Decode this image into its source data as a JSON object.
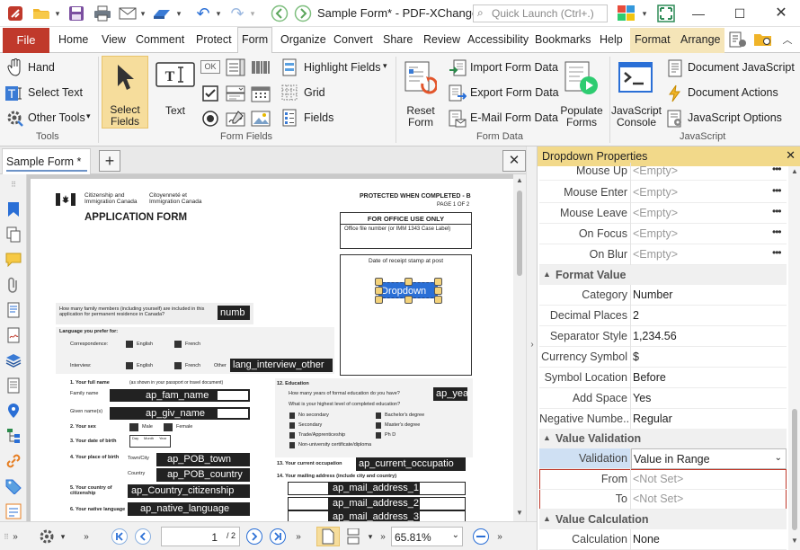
{
  "titlebar": {
    "title": "Sample Form* - PDF-XChange ...",
    "quick_launch_placeholder": "Quick Launch (Ctrl+.)"
  },
  "menu": {
    "file": "File",
    "tabs": [
      "Home",
      "View",
      "Comment",
      "Protect",
      "Form",
      "Organize",
      "Convert",
      "Share",
      "Review",
      "Accessibility",
      "Bookmarks",
      "Help",
      "Format",
      "Arrange"
    ],
    "active": "Form"
  },
  "ribbon": {
    "tools": {
      "hand": "Hand",
      "select_text": "Select Text",
      "other_tools": "Other Tools",
      "group": "Tools"
    },
    "form_fields": {
      "select_fields": "Select Fields",
      "text": "Text",
      "highlight_fields": "Highlight Fields",
      "grid": "Grid",
      "fields": "Fields",
      "group": "Form Fields",
      "ok_label": "OK"
    },
    "form_data": {
      "reset_form": "Reset Form",
      "import": "Import Form Data",
      "export": "Export Form Data",
      "email": "E-Mail Form Data",
      "populate": "Populate Forms",
      "group": "Form Data"
    },
    "javascript": {
      "console": "JavaScript Console",
      "doc_js": "Document JavaScript",
      "doc_actions": "Document Actions",
      "js_options": "JavaScript Options",
      "group": "JavaScript"
    }
  },
  "document_tab": {
    "name": "Sample Form *"
  },
  "document": {
    "header_left1": "Citizenship and Immigration Canada",
    "header_left2": "Citoyenneté et Immigration Canada",
    "protected": "PROTECTED WHEN COMPLETED - B",
    "page_of": "PAGE 1 OF 2",
    "title": "APPLICATION FORM",
    "office_use": "FOR OFFICE USE ONLY",
    "office_file": "Office file number (or IMM 1343 Case Label)",
    "receipt_stamp": "Date of receipt stamp at post",
    "dropdown_label": "Dropdown",
    "family_members_q": "How many family members (including yourself) are included in this application for permanent residence in Canada?",
    "family_members_field": "numb",
    "lang_pref": "Language you prefer for:",
    "correspondence": "Correspondence:",
    "interview": "Interview:",
    "english": "English",
    "french": "French",
    "other": "Other",
    "lang_interview_other": "lang_interview_other",
    "q1": "1.  Your full name",
    "q1_note": "(as shown in your passport or travel document)",
    "family_name": "Family name",
    "given_names": "Given name(s)",
    "fam_name_field": "ap_fam_name",
    "giv_name_field": "ap_giv_name",
    "q2": "2.  Your sex",
    "male": "Male",
    "female": "Female",
    "q3": "3.  Your date of birth",
    "dob_cols": [
      "Day",
      "Month",
      "Year"
    ],
    "q4": "4.  Your place of birth",
    "town_city": "Town/City",
    "country": "Country",
    "pob_town_field": "ap_POB_town",
    "pob_country_field": "ap_POB_country",
    "q5": "5.  Your country of citizenship",
    "country_citizenship_field": "ap_Country_citizenship",
    "q6": "6.  Your native language",
    "native_language_field": "ap_native_language",
    "q12": "12.  Education",
    "edu_years_q": "How many years of formal education do you have?",
    "edu_years_field": "ap_yea",
    "edu_level_q": "What is your highest level of completed education?",
    "edu_options": [
      "No secondary",
      "Secondary",
      "Trade/Apprenticeship",
      "Non-university certificate/diploma",
      "Bachelor's degree",
      "Master's degree",
      "Ph D"
    ],
    "q13": "13.  Your current occupation",
    "current_occupation_field": "ap_current_occupatio",
    "q14": "14.  Your mailing address (include city and country)",
    "mail_fields": [
      "ap_mail_address_1",
      "ap_mail_address_2",
      "ap_mail_address_3"
    ]
  },
  "status": {
    "page_current": "1",
    "page_total": "/ 2",
    "zoom": "65.81%"
  },
  "panel": {
    "title": "Dropdown Properties",
    "empty_value": "<Empty>",
    "not_set_value": "<Not Set>",
    "actions": [
      {
        "key": "Mouse Up",
        "value": "<Empty>"
      },
      {
        "key": "Mouse Enter",
        "value": "<Empty>"
      },
      {
        "key": "Mouse Leave",
        "value": "<Empty>"
      },
      {
        "key": "On Focus",
        "value": "<Empty>"
      },
      {
        "key": "On Blur",
        "value": "<Empty>"
      }
    ],
    "format_section": "Format Value",
    "format": [
      {
        "key": "Category",
        "value": "Number"
      },
      {
        "key": "Decimal Places",
        "value": "2"
      },
      {
        "key": "Separator Style",
        "value": "1,234.56"
      },
      {
        "key": "Currency Symbol",
        "value": "$"
      },
      {
        "key": "Symbol Location",
        "value": "Before"
      },
      {
        "key": "Add Space",
        "value": "Yes"
      },
      {
        "key": "Negative Numbe..",
        "value": "Regular"
      }
    ],
    "validation_section": "Value Validation",
    "validation": {
      "key": "Validation",
      "value": "Value in Range"
    },
    "range": [
      {
        "key": "From",
        "value": "<Not Set>"
      },
      {
        "key": "To",
        "value": "<Not Set>"
      }
    ],
    "calculation_section": "Value Calculation",
    "calculation": {
      "key": "Calculation",
      "value": "None"
    }
  },
  "colors": {
    "file_tab": "#c0392b",
    "panel_header": "#f2d98a",
    "context_tab": "#f5e5b8",
    "selection": "#cfe0f3",
    "accent_blue": "#2a6fd6"
  }
}
